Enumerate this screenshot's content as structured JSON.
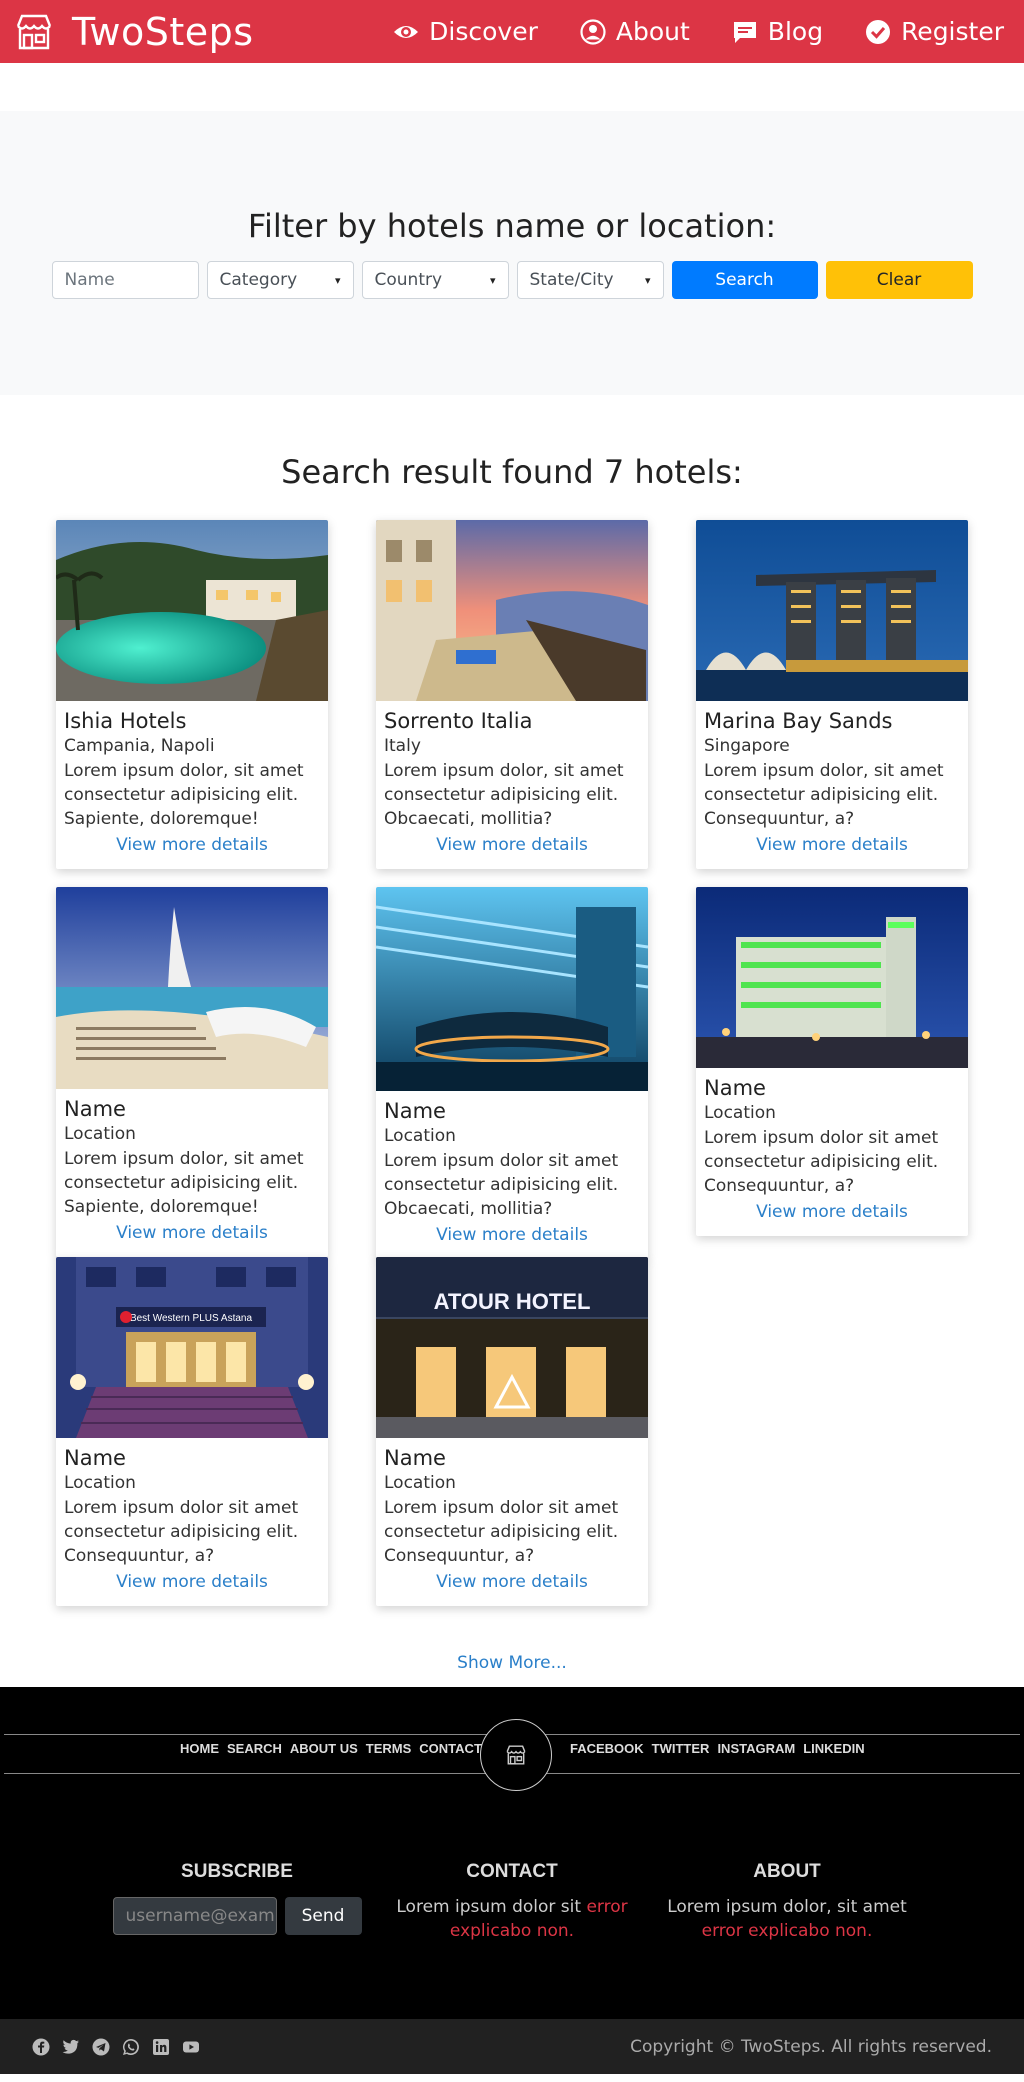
{
  "navbar": {
    "brand": "TwoSteps",
    "links": [
      {
        "label": "Discover",
        "icon": "eye-icon"
      },
      {
        "label": "About",
        "icon": "user-circle-icon"
      },
      {
        "label": "Blog",
        "icon": "chat-icon"
      },
      {
        "label": "Register",
        "icon": "check-circle-icon"
      }
    ]
  },
  "filter": {
    "title": "Filter by hotels name or location:",
    "name_placeholder": "Name",
    "category": "Category",
    "country": "Country",
    "state": "State/City",
    "search_label": "Search",
    "clear_label": "Clear"
  },
  "results": {
    "title": "Search result found 7 hotels:",
    "link_label": "View more details",
    "show_more": "Show More...",
    "hotels": [
      {
        "name": "Ishia Hotels",
        "location": "Campania, Napoli",
        "text": "Lorem ipsum dolor, sit amet consectetur adipisicing elit. Sapiente, doloremque!",
        "scene": "resort-pool"
      },
      {
        "name": "Sorrento Italia",
        "location": "Italy",
        "text": "Lorem ipsum dolor, sit amet consectetur adipisicing elit. Obcaecati, mollitia?",
        "scene": "sunset-coast"
      },
      {
        "name": "Marina Bay Sands",
        "location": "Singapore",
        "text": "Lorem ipsum dolor, sit amet consectetur adipisicing elit. Consequuntur, a?",
        "scene": "night-towers"
      },
      {
        "name": "Name",
        "location": "Location",
        "text": "Lorem ipsum dolor, sit amet consectetur adipisicing elit. Sapiente, doloremque!",
        "scene": "beach-tower"
      },
      {
        "name": "Name",
        "location": "Location",
        "text": "Lorem ipsum dolor sit amet consectetur adipisicing elit. Obcaecati, mollitia?",
        "scene": "blue-lobby"
      },
      {
        "name": "Name",
        "location": "Location",
        "text": "Lorem ipsum dolor sit amet consectetur adipisicing elit. Consequuntur, a?",
        "scene": "green-hotel"
      },
      {
        "name": "Name",
        "location": "Location",
        "text": "Lorem ipsum dolor sit amet consectetur adipisicing elit. Consequuntur, a?",
        "scene": "best-western",
        "sign": "Best Western PLUS Astana"
      },
      {
        "name": "Name",
        "location": "Location",
        "text": "Lorem ipsum dolor sit amet consectetur adipisicing elit. Consequuntur, a?",
        "scene": "atour-hotel",
        "sign": "ATOUR HOTEL"
      }
    ]
  },
  "footer": {
    "left_links": [
      "HOME",
      "SEARCH",
      "ABOUT US",
      "TERMS",
      "CONTACT"
    ],
    "right_links": [
      "FACEBOOK",
      "TWITTER",
      "INSTAGRAM",
      "LINKEDIN"
    ],
    "subscribe": {
      "title": "SUBSCRIBE",
      "placeholder": "username@example.com",
      "button": "Send"
    },
    "contact": {
      "title": "CONTACT",
      "text": "Lorem ipsum dolor sit",
      "red": "error explicabo non."
    },
    "about": {
      "title": "ABOUT",
      "text": "Lorem ipsum dolor, sit amet",
      "red": "error explicabo non."
    },
    "social_icons": [
      "facebook-icon",
      "twitter-icon",
      "telegram-icon",
      "whatsapp-icon",
      "linkedin-icon",
      "youtube-icon"
    ],
    "copyright": "Copyright © TwoSteps. All rights reserved."
  },
  "colors": {
    "brand_red": "#dc3545",
    "search_blue": "#007bff",
    "clear_yellow": "#ffc107",
    "link_blue": "#2a7fc9"
  }
}
